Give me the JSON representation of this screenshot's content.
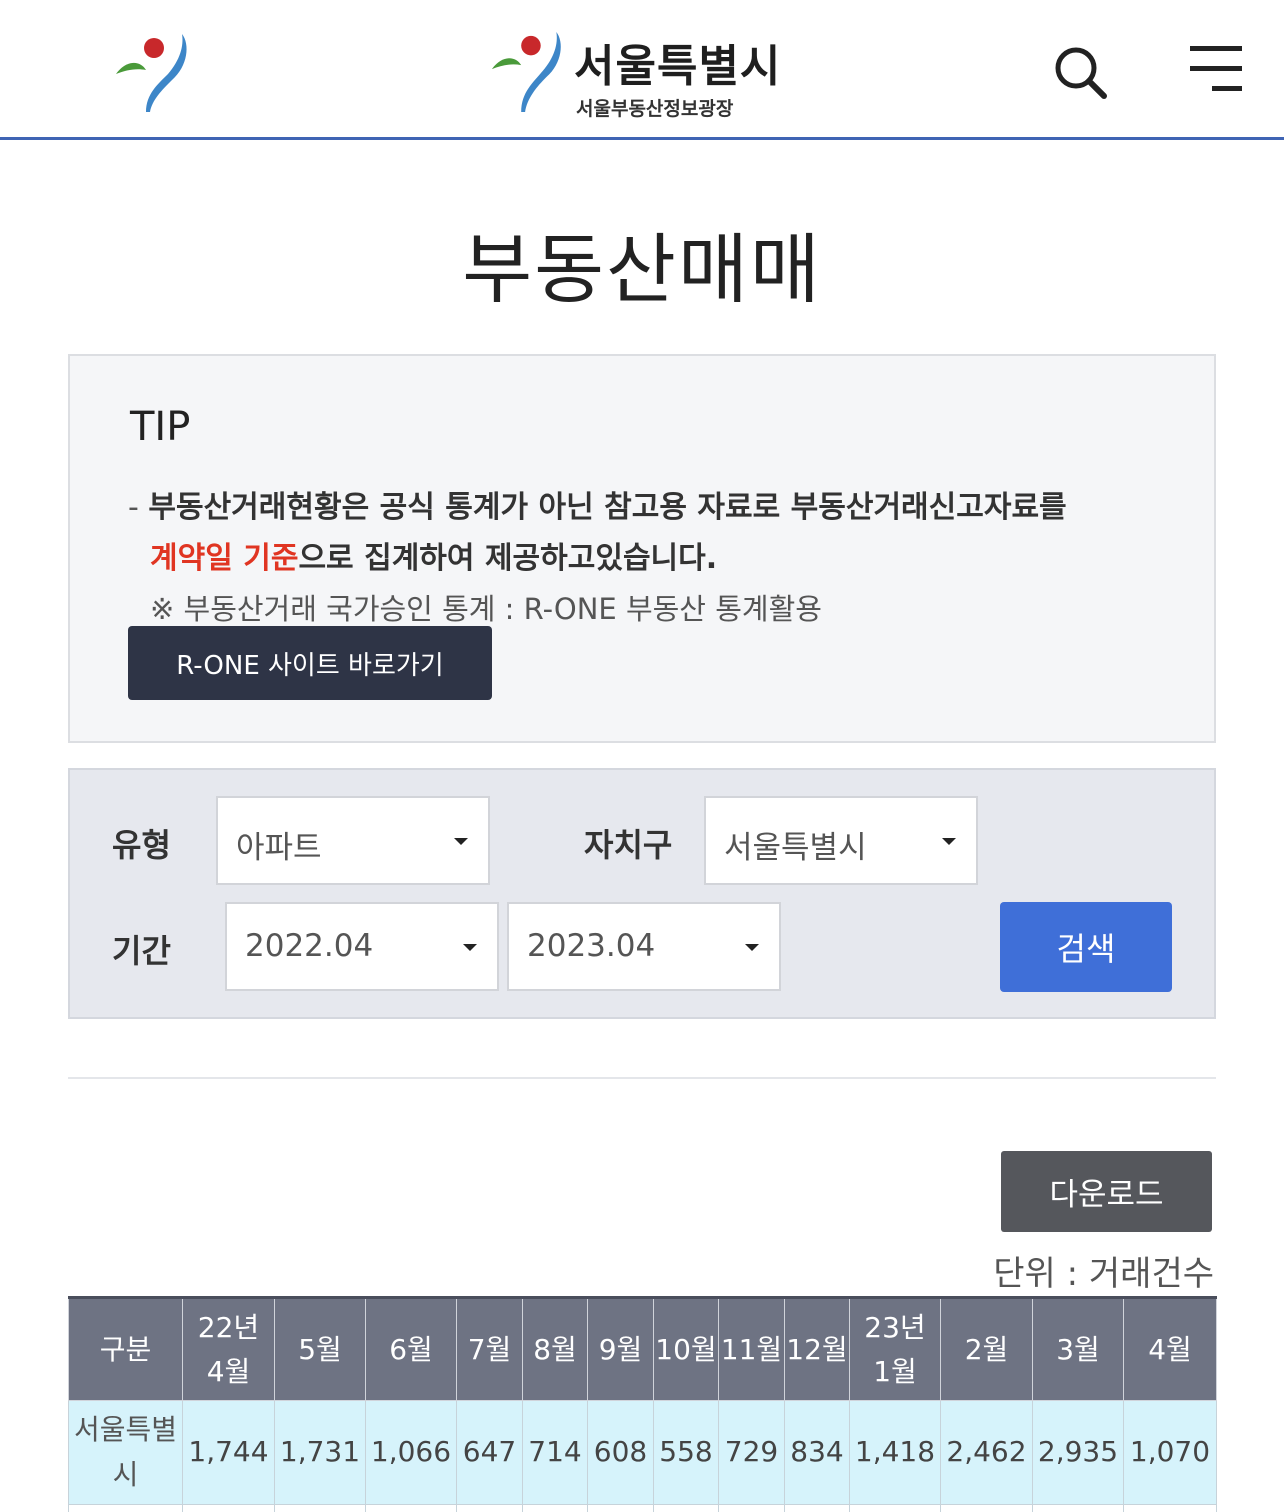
{
  "header": {
    "site_title": "서울특별시",
    "site_subtitle": "서울부동산정보광장"
  },
  "page": {
    "title": "부동산매매"
  },
  "tip": {
    "heading": "TIP",
    "dash": "- ",
    "line1": "부동산거래현황은 공식 통계가 아닌 참고용 자료로 부동산거래신고자료를",
    "line2_highlight": "계약일 기준",
    "line2_rest": "으로 집계하여 제공하고있습니다.",
    "note": "※ 부동산거래 국가승인 통계 : R-ONE 부동산 통계활용",
    "button_label": "R-ONE 사이트 바로가기",
    "highlight_color": "#e03522"
  },
  "filters": {
    "type_label": "유형",
    "type_value": "아파트",
    "district_label": "자치구",
    "district_value": "서울특별시",
    "period_label": "기간",
    "period_start": "2022.04",
    "period_end": "2023.04",
    "search_label": "검색",
    "search_color": "#3f6fd8"
  },
  "results": {
    "download_label": "다운로드",
    "unit_text": "단위  :  거래건수"
  },
  "table": {
    "headers": [
      [
        "구분"
      ],
      [
        "22년",
        "4월"
      ],
      [
        "5월"
      ],
      [
        "6월"
      ],
      [
        "7월"
      ],
      [
        "8월"
      ],
      [
        "9월"
      ],
      [
        "10월"
      ],
      [
        "11월"
      ],
      [
        "12월"
      ],
      [
        "23년",
        "1월"
      ],
      [
        "2월"
      ],
      [
        "3월"
      ],
      [
        "4월"
      ]
    ],
    "rows": [
      {
        "region": [
          "서울특별",
          "시"
        ],
        "values": [
          "1,744",
          "1,731",
          "1,066",
          "647",
          "714",
          "608",
          "558",
          "729",
          "834",
          "1,418",
          "2,462",
          "2,935",
          "1,070"
        ]
      }
    ]
  }
}
